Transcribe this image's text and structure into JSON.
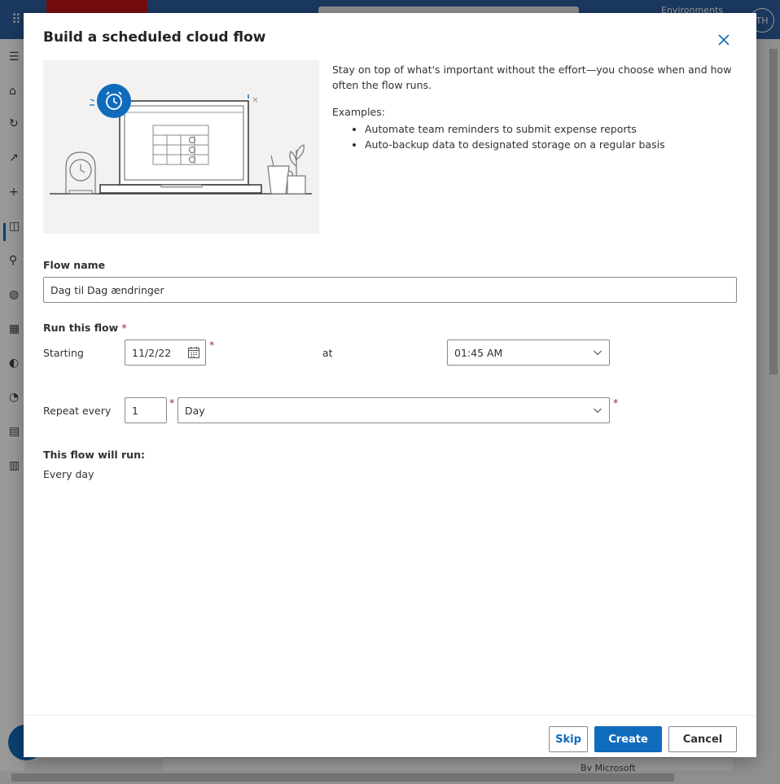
{
  "background": {
    "environments_label": "Environments",
    "avatar_initials": "TH",
    "by_microsoft": "By Microsoft"
  },
  "dialog": {
    "title": "Build a scheduled cloud flow",
    "description": "Stay on top of what's important without the effort—you choose when and how often the flow runs.",
    "examples_label": "Examples:",
    "examples": [
      "Automate team reminders to submit expense reports",
      "Auto-backup data to designated storage on a regular basis"
    ],
    "flow_name_label": "Flow name",
    "flow_name_value": "Dag til Dag ændringer",
    "run_this_flow_label": "Run this flow",
    "required_marker": "*",
    "starting_label": "Starting",
    "start_date": "11/2/22",
    "at_label": "at",
    "start_time": "01:45 AM",
    "repeat_every_label": "Repeat every",
    "repeat_interval": "1",
    "repeat_unit": "Day",
    "will_run_label": "This flow will run:",
    "will_run_value": "Every day",
    "buttons": {
      "skip": "Skip",
      "create": "Create",
      "cancel": "Cancel"
    }
  },
  "colors": {
    "accent": "#0f6cbd",
    "required": "#a4262c"
  }
}
